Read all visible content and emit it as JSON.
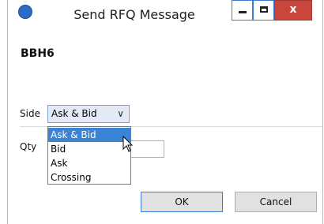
{
  "window": {
    "title": "Send RFQ Message",
    "icon": "app-icon",
    "controls": {
      "minimize": "minimize-icon",
      "maximize": "maximize-icon",
      "close": "x"
    }
  },
  "symbol": "BBH6",
  "form": {
    "side_label": "Side",
    "side_value": "Ask & Bid",
    "qty_label": "Qty",
    "qty_value": ""
  },
  "dropdown": {
    "options": [
      "Ask & Bid",
      "Bid",
      "Ask",
      "Crossing"
    ],
    "highlighted": "Ask & Bid"
  },
  "buttons": {
    "ok": "OK",
    "cancel": "Cancel"
  },
  "colors": {
    "accent": "#3b83d4",
    "close": "#c9463d"
  }
}
